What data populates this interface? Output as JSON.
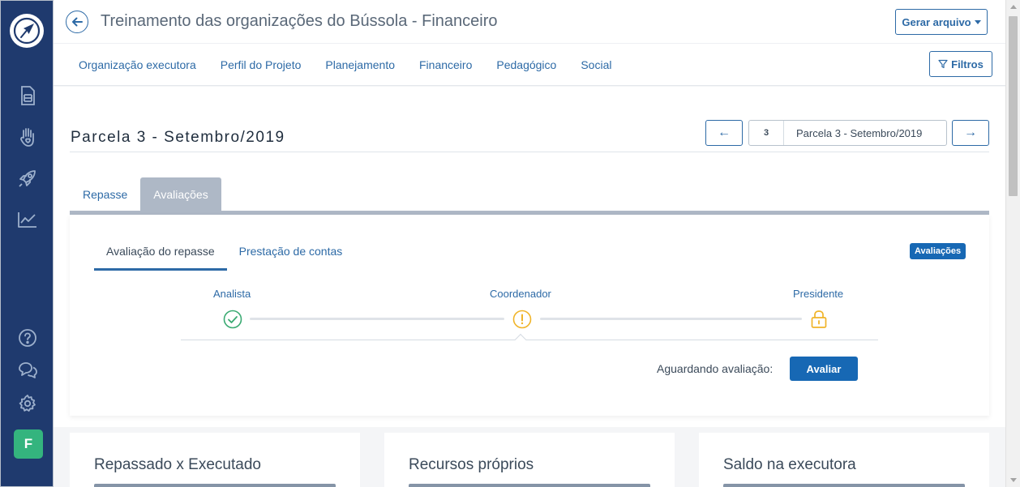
{
  "header": {
    "title": "Treinamento das organizações do Bússola - Financeiro",
    "gerar_label": "Gerar arquivo",
    "filtros_label": "Filtros"
  },
  "nav": {
    "items": [
      "Organização executora",
      "Perfil do Projeto",
      "Planejamento",
      "Financeiro",
      "Pedagógico",
      "Social"
    ]
  },
  "parcela": {
    "title": "Parcela 3 - Setembro/2019",
    "pager_number": "3",
    "pager_label": "Parcela 3 - Setembro/2019",
    "prev_symbol": "←",
    "next_symbol": "→"
  },
  "tabs": {
    "repasse": "Repasse",
    "avaliacoes": "Avaliações"
  },
  "subtabs": {
    "avaliacao_repasse": "Avaliação do repasse",
    "prestacao_contas": "Prestação de contas"
  },
  "badge": "Avaliações",
  "stages": [
    {
      "label": "Analista",
      "status": "done",
      "icon": "check-circle-icon",
      "color": "#3aaa72"
    },
    {
      "label": "Coordenador",
      "status": "pending",
      "icon": "exclamation-circle-icon",
      "color": "#f0b429"
    },
    {
      "label": "Presidente",
      "status": "locked",
      "icon": "lock-icon",
      "color": "#f0b429"
    }
  ],
  "avaliacao": {
    "aguardando_label": "Aguardando avaliação:",
    "avaliar_label": "Avaliar"
  },
  "cards": [
    {
      "title": "Repassado x Executado"
    },
    {
      "title": "Recursos próprios"
    },
    {
      "title": "Saldo na executora"
    }
  ],
  "user": {
    "initial": "F"
  },
  "colors": {
    "sidebar": "#1f3a6e",
    "accent": "#2d6aa6",
    "primary_button": "#1768b4",
    "avatar": "#34b47e"
  }
}
